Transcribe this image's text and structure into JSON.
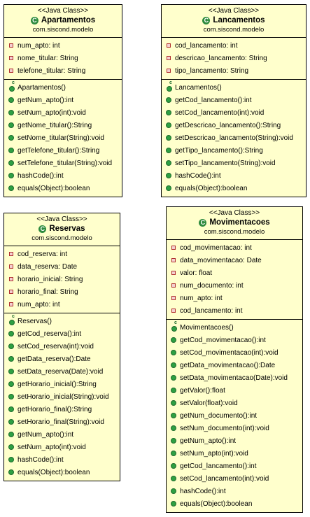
{
  "classes": [
    {
      "stereotype": "<<Java Class>>",
      "name": "Apartamentos",
      "package": "com.siscond.modelo",
      "fields": [
        "num_apto: int",
        "nome_titular: String",
        "telefone_titular: String"
      ],
      "methods": [
        "Apartamentos()",
        "getNum_apto():int",
        "setNum_apto(int):void",
        "getNome_titular():String",
        "setNome_titular(String):void",
        "getTelefone_titular():String",
        "setTelefone_titular(String):void",
        "hashCode():int",
        "equals(Object):boolean"
      ]
    },
    {
      "stereotype": "<<Java Class>>",
      "name": "Lancamentos",
      "package": "com.siscond.modelo",
      "fields": [
        "cod_lancamento: int",
        "descricao_lancamento: String",
        "tipo_lancamento: String"
      ],
      "methods": [
        "Lancamentos()",
        "getCod_lancamento():int",
        "setCod_lancamento(int):void",
        "getDescricao_lancamento():String",
        "setDescricao_lancamento(String):void",
        "getTipo_lancamento():String",
        "setTipo_lancamento(String):void",
        "hashCode():int",
        "equals(Object):boolean"
      ]
    },
    {
      "stereotype": "<<Java Class>>",
      "name": "Reservas",
      "package": "com.siscond.modelo",
      "fields": [
        "cod_reserva: int",
        "data_reserva: Date",
        "horario_inicial: String",
        "horario_final: String",
        "num_apto: int"
      ],
      "methods": [
        "Reservas()",
        "getCod_reserva():int",
        "setCod_reserva(int):void",
        "getData_reserva():Date",
        "setData_reserva(Date):void",
        "getHorario_inicial():String",
        "setHorario_inicial(String):void",
        "getHorario_final():String",
        "setHorario_final(String):void",
        "getNum_apto():int",
        "setNum_apto(int):void",
        "hashCode():int",
        "equals(Object):boolean"
      ]
    },
    {
      "stereotype": "<<Java Class>>",
      "name": "Movimentacoes",
      "package": "com.siscond.modelo",
      "fields": [
        "cod_movimentacao: int",
        "data_movimentacao: Date",
        "valor: float",
        "num_documento: int",
        "num_apto: int",
        "cod_lancamento: int"
      ],
      "methods": [
        "Movimentacoes()",
        "getCod_movimentacao():int",
        "setCod_movimentacao(int):void",
        "getData_movimentacao():Date",
        "setData_movimentacao(Date):void",
        "getValor():float",
        "setValor(float):void",
        "getNum_documento():int",
        "setNum_documento(int):void",
        "getNum_apto():int",
        "setNum_apto(int):void",
        "getCod_lancamento():int",
        "setCod_lancamento(int):void",
        "hashCode():int",
        "equals(Object):boolean"
      ]
    }
  ]
}
